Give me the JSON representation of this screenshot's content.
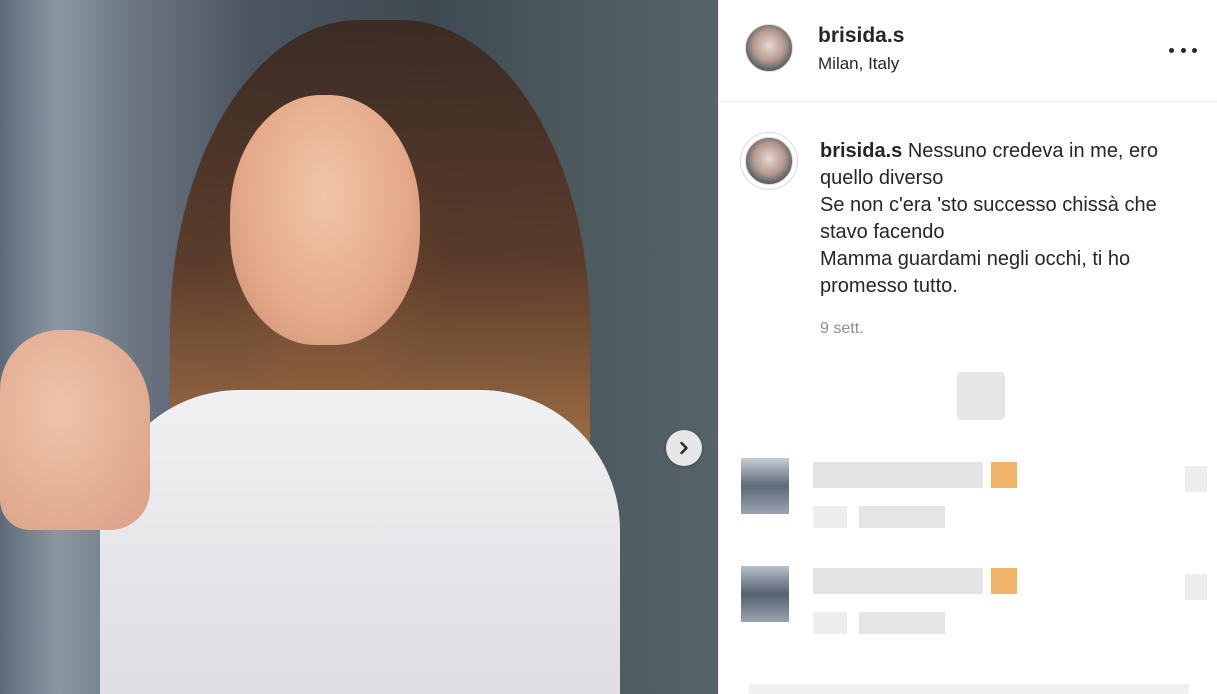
{
  "post": {
    "username": "brisida.s",
    "location": "Milan, Italy",
    "caption_lines": [
      "Nessuno credeva in me, ero",
      "quello diverso",
      "Se non c'era 'sto successo chissà che",
      "stavo facendo",
      "Mamma guardami negli occhi, ti ho",
      "promesso tutto."
    ],
    "timestamp": "9 sett."
  },
  "icons": {
    "next": "chevron-right-icon",
    "more": "more-options-icon"
  },
  "colors": {
    "text": "#262626",
    "secondary": "#8e8e8e",
    "border": "#efefef"
  }
}
